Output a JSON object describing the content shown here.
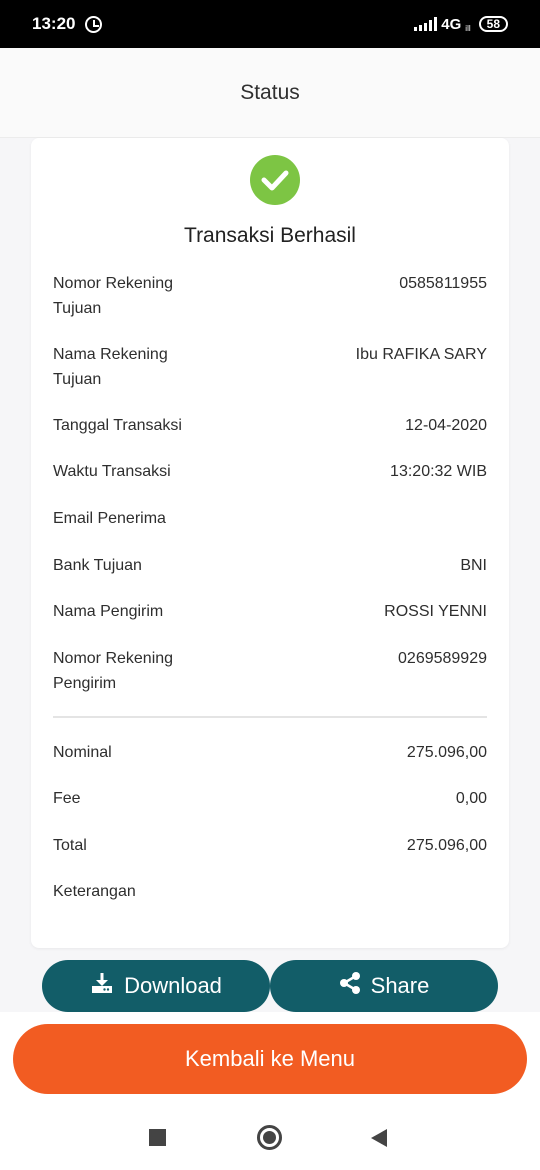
{
  "status_bar": {
    "time": "13:20",
    "network": "4G",
    "network_sub": "ill",
    "battery": "58"
  },
  "header": {
    "title": "Status"
  },
  "card": {
    "title": "Transaksi Berhasil",
    "details": [
      {
        "label": "Nomor Rekening Tujuan",
        "value": "0585811955"
      },
      {
        "label": "Nama Rekening Tujuan",
        "value": "Ibu RAFIKA SARY"
      },
      {
        "label": "Tanggal Transaksi",
        "value": "12-04-2020"
      },
      {
        "label": "Waktu Transaksi",
        "value": "13:20:32 WIB"
      },
      {
        "label": "Email Penerima",
        "value": ""
      },
      {
        "label": "Bank Tujuan",
        "value": "BNI"
      },
      {
        "label": "Nama Pengirim",
        "value": "ROSSI YENNI"
      },
      {
        "label": "Nomor Rekening Pengirim",
        "value": "0269589929"
      }
    ],
    "summary": [
      {
        "label": "Nominal",
        "value": "275.096,00"
      },
      {
        "label": "Fee",
        "value": "0,00"
      },
      {
        "label": "Total",
        "value": "275.096,00"
      },
      {
        "label": "Keterangan",
        "value": ""
      }
    ]
  },
  "actions": {
    "download_label": "Download",
    "share_label": "Share",
    "menu_label": "Kembali ke Menu"
  },
  "icons": {
    "success": "check-circle-icon",
    "download": "download-icon",
    "share": "share-icon",
    "alarm": "alarm-icon"
  },
  "colors": {
    "success_green": "#7dc544",
    "button_teal": "#125d68",
    "primary_orange": "#f25c22"
  }
}
